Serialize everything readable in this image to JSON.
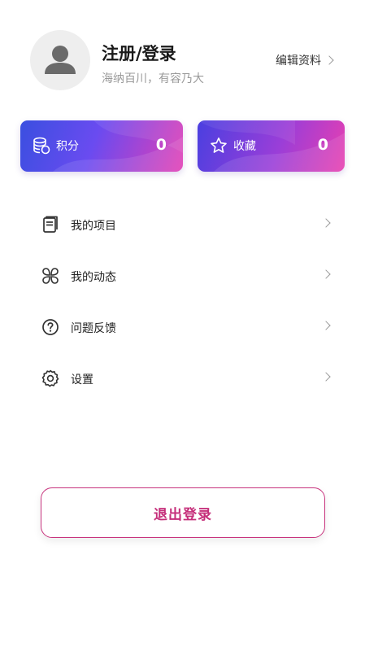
{
  "profile": {
    "name": "注册/登录",
    "motto": "海纳百川，有容乃大",
    "edit_label": "编辑资料"
  },
  "cards": {
    "points": {
      "label": "积分",
      "value": "0",
      "icon": "coins-stack-icon"
    },
    "favorites": {
      "label": "收藏",
      "value": "0",
      "icon": "star-outline-icon"
    }
  },
  "menu": {
    "items": [
      {
        "label": "我的项目",
        "icon": "book-icon"
      },
      {
        "label": "我的动态",
        "icon": "clover-icon"
      },
      {
        "label": "问题反馈",
        "icon": "question-circle-icon"
      },
      {
        "label": "设置",
        "icon": "gear-icon"
      }
    ]
  },
  "logout": {
    "label": "退出登录"
  },
  "colors": {
    "accent": "#c52e7a",
    "card_gradient_start": "#3a4fe0",
    "card_gradient_end": "#e33fb5"
  }
}
